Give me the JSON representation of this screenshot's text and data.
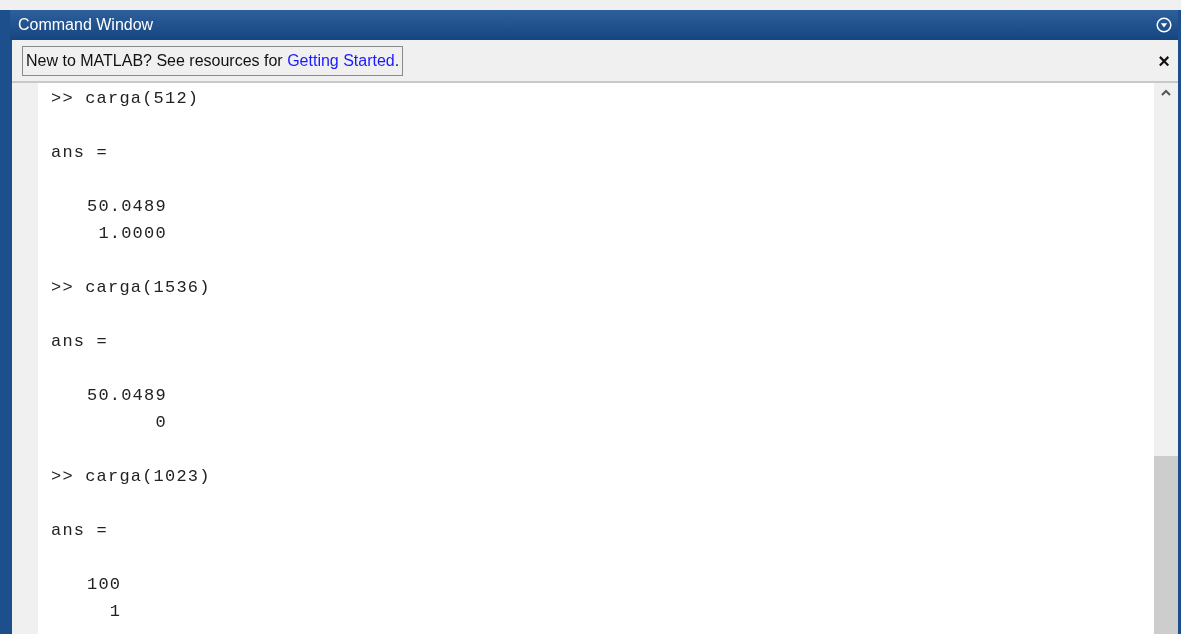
{
  "window": {
    "title": "Command Window"
  },
  "notice": {
    "text": "New to MATLAB? See resources for ",
    "link": "Getting Started",
    "suffix": ".",
    "close_glyph": "×"
  },
  "entries": [
    {
      "command": ">> carga(512)",
      "result_label": "ans =",
      "values": [
        "50.0489",
        "1.0000"
      ]
    },
    {
      "command": ">> carga(1536)",
      "result_label": "ans =",
      "values": [
        "50.0489",
        "0"
      ]
    },
    {
      "command": ">> carga(1023)",
      "result_label": "ans =",
      "values": [
        "100",
        "1"
      ]
    }
  ]
}
